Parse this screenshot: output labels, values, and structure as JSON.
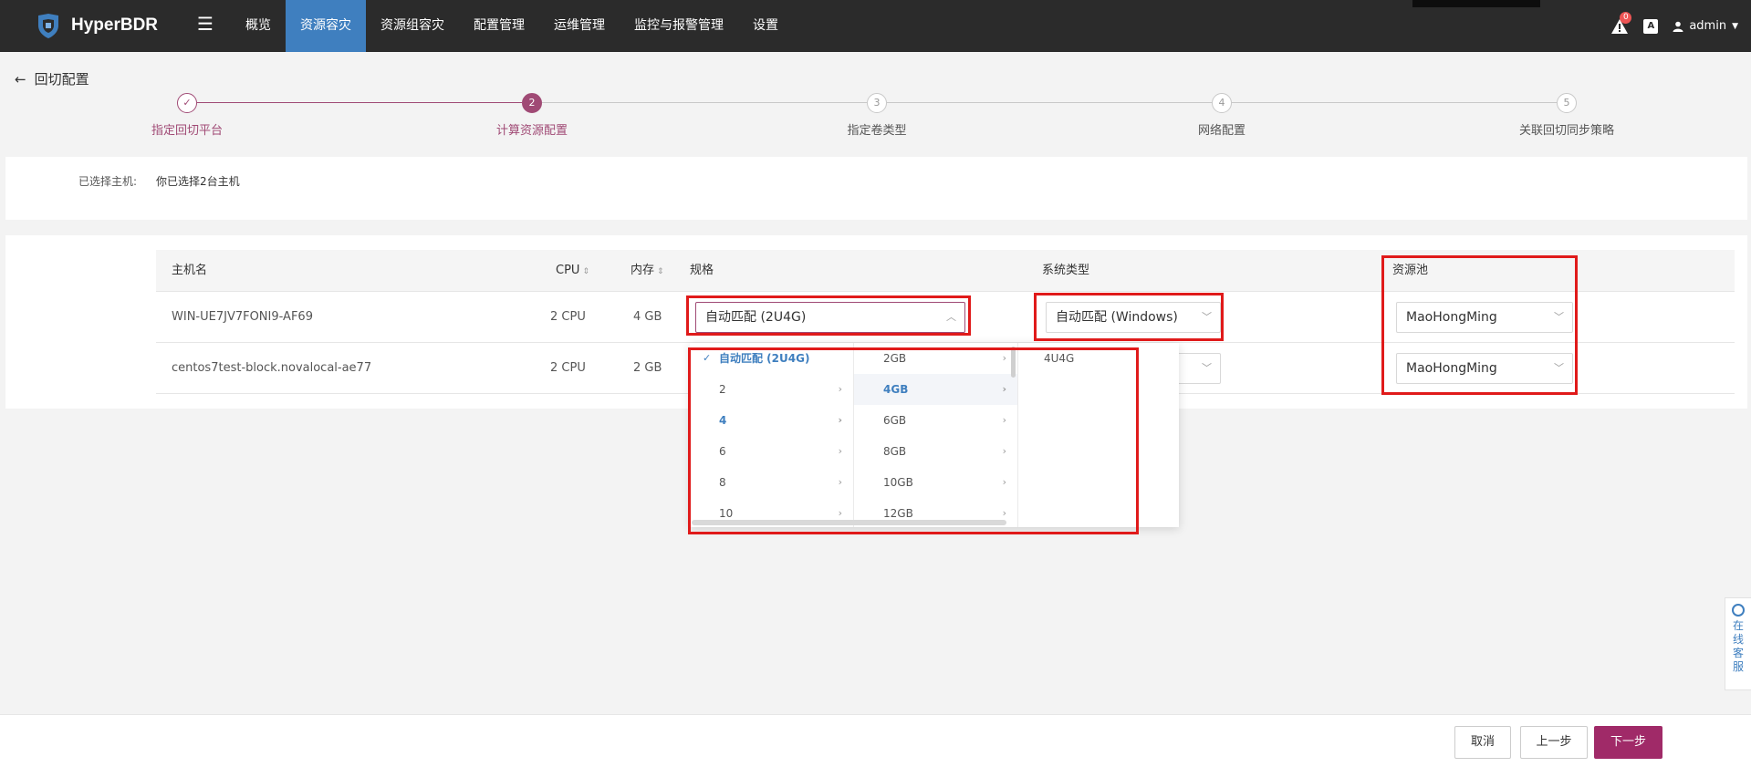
{
  "app": {
    "name": "HyperBDR"
  },
  "nav": {
    "items": [
      {
        "label": "概览",
        "active": false
      },
      {
        "label": "资源容灾",
        "active": true
      },
      {
        "label": "资源组容灾",
        "active": false
      },
      {
        "label": "配置管理",
        "active": false
      },
      {
        "label": "运维管理",
        "active": false
      },
      {
        "label": "监控与报警管理",
        "active": false
      },
      {
        "label": "设置",
        "active": false
      }
    ]
  },
  "topright": {
    "alert_count": "0",
    "lang_icon": "A",
    "user": "admin"
  },
  "page": {
    "title": "回切配置"
  },
  "steps": [
    {
      "num": "✓",
      "label": "指定回切平台",
      "state": "done"
    },
    {
      "num": "2",
      "label": "计算资源配置",
      "state": "current"
    },
    {
      "num": "3",
      "label": "指定卷类型",
      "state": "todo"
    },
    {
      "num": "4",
      "label": "网络配置",
      "state": "todo"
    },
    {
      "num": "5",
      "label": "关联回切同步策略",
      "state": "todo"
    }
  ],
  "selected": {
    "label": "已选择主机:",
    "value": "你已选择2台主机"
  },
  "table": {
    "headers": {
      "host": "主机名",
      "cpu": "CPU",
      "mem": "内存",
      "flavor": "规格",
      "os": "系统类型",
      "pool": "资源池"
    },
    "rows": [
      {
        "host": "WIN-UE7JV7FONI9-AF69",
        "cpu": "2 CPU",
        "mem": "4 GB",
        "flavor": "自动匹配 (2U4G)",
        "os": "自动匹配 (Windows)",
        "pool": "MaoHongMing"
      },
      {
        "host": "centos7test-block.novalocal-ae77",
        "cpu": "2 CPU",
        "mem": "2 GB",
        "flavor": "",
        "os": "",
        "pool": "MaoHongMing"
      }
    ]
  },
  "cascader": {
    "col1": [
      {
        "label": "自动匹配 (2U4G)",
        "state": "selected",
        "has_children": false
      },
      {
        "label": "2",
        "state": "",
        "has_children": true
      },
      {
        "label": "4",
        "state": "selected",
        "has_children": true
      },
      {
        "label": "6",
        "state": "",
        "has_children": true
      },
      {
        "label": "8",
        "state": "",
        "has_children": true
      },
      {
        "label": "10",
        "state": "",
        "has_children": true
      }
    ],
    "col2": [
      {
        "label": "2GB",
        "state": ""
      },
      {
        "label": "4GB",
        "state": "active"
      },
      {
        "label": "6GB",
        "state": ""
      },
      {
        "label": "8GB",
        "state": ""
      },
      {
        "label": "10GB",
        "state": ""
      },
      {
        "label": "12GB",
        "state": ""
      }
    ],
    "col3": [
      {
        "label": "4U4G"
      }
    ]
  },
  "footer": {
    "cancel": "取消",
    "prev": "上一步",
    "next": "下一步"
  },
  "side": {
    "label": "在线客服"
  },
  "colors": {
    "accent": "#a04a75",
    "nav_active": "#3f7fbf",
    "primary_btn": "#a02a68",
    "annotation_red": "#e01a1a"
  }
}
